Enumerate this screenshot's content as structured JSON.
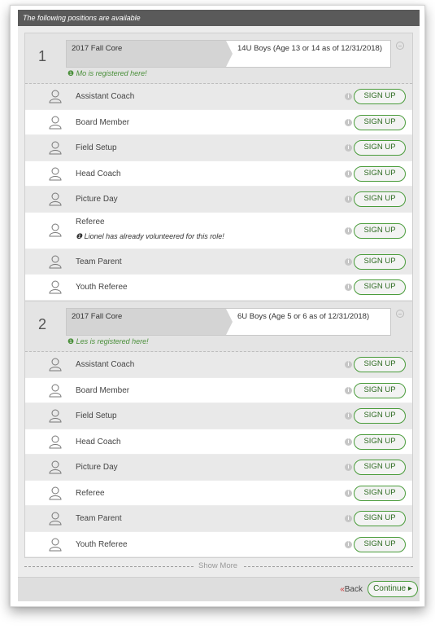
{
  "header": {
    "title": "The following positions are available"
  },
  "teams": [
    {
      "number": "1",
      "season": "2017 Fall Core",
      "division": "14U Boys (Age 13 or 14 as of 12/31/2018)",
      "registered_note": "Mo is registered here!",
      "roles": [
        {
          "label": "Assistant Coach",
          "note": ""
        },
        {
          "label": "Board Member",
          "note": ""
        },
        {
          "label": "Field Setup",
          "note": ""
        },
        {
          "label": "Head Coach",
          "note": ""
        },
        {
          "label": "Picture Day",
          "note": ""
        },
        {
          "label": "Referee",
          "note": "Lionel has already volunteered for this role!"
        },
        {
          "label": "Team Parent",
          "note": ""
        },
        {
          "label": "Youth Referee",
          "note": ""
        }
      ]
    },
    {
      "number": "2",
      "season": "2017 Fall Core",
      "division": "6U Boys (Age 5 or 6 as of 12/31/2018)",
      "registered_note": "Les is registered here!",
      "roles": [
        {
          "label": "Assistant Coach",
          "note": ""
        },
        {
          "label": "Board Member",
          "note": ""
        },
        {
          "label": "Field Setup",
          "note": ""
        },
        {
          "label": "Head Coach",
          "note": ""
        },
        {
          "label": "Picture Day",
          "note": ""
        },
        {
          "label": "Referee",
          "note": ""
        },
        {
          "label": "Team Parent",
          "note": ""
        },
        {
          "label": "Youth Referee",
          "note": ""
        }
      ]
    }
  ],
  "signup_label": "SIGN UP",
  "info_glyph": "i",
  "show_more_label": "Show More",
  "footer": {
    "back_chevron": "«",
    "back_label": "Back",
    "continue_label": "Continue ▸"
  },
  "colors": {
    "accent_green": "#4a9c3b",
    "header_bg": "#5a5a5a",
    "back_chevron": "#cc3333"
  },
  "icons": {
    "role": "user-outline-icon",
    "info": "info-icon",
    "collapse": "collapse-icon"
  }
}
